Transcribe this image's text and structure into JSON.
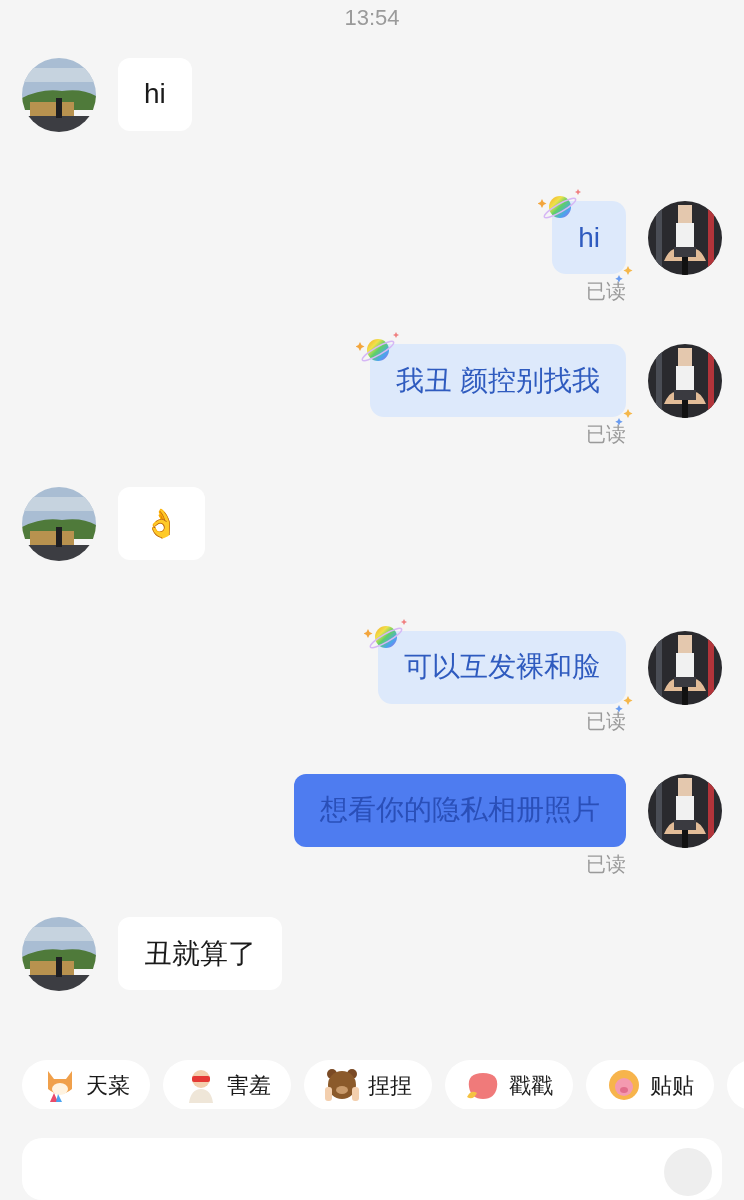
{
  "status_time": "13:54",
  "messages": [
    {
      "kind": "received",
      "text": "hi"
    },
    {
      "kind": "sent_themed",
      "text": "hi",
      "status": "已读"
    },
    {
      "kind": "sent_themed",
      "text": "我丑 颜控别找我",
      "status": "已读"
    },
    {
      "kind": "received",
      "text": "👌"
    },
    {
      "kind": "sent_themed",
      "text": "可以互发裸和脸",
      "status": "已读"
    },
    {
      "kind": "sent",
      "text": "想看你的隐私相册照片",
      "status": "已读"
    },
    {
      "kind": "received",
      "text": "丑就算了"
    }
  ],
  "quick_replies": [
    "天菜",
    "害羞",
    "捏捏",
    "戳戳",
    "贴贴"
  ]
}
